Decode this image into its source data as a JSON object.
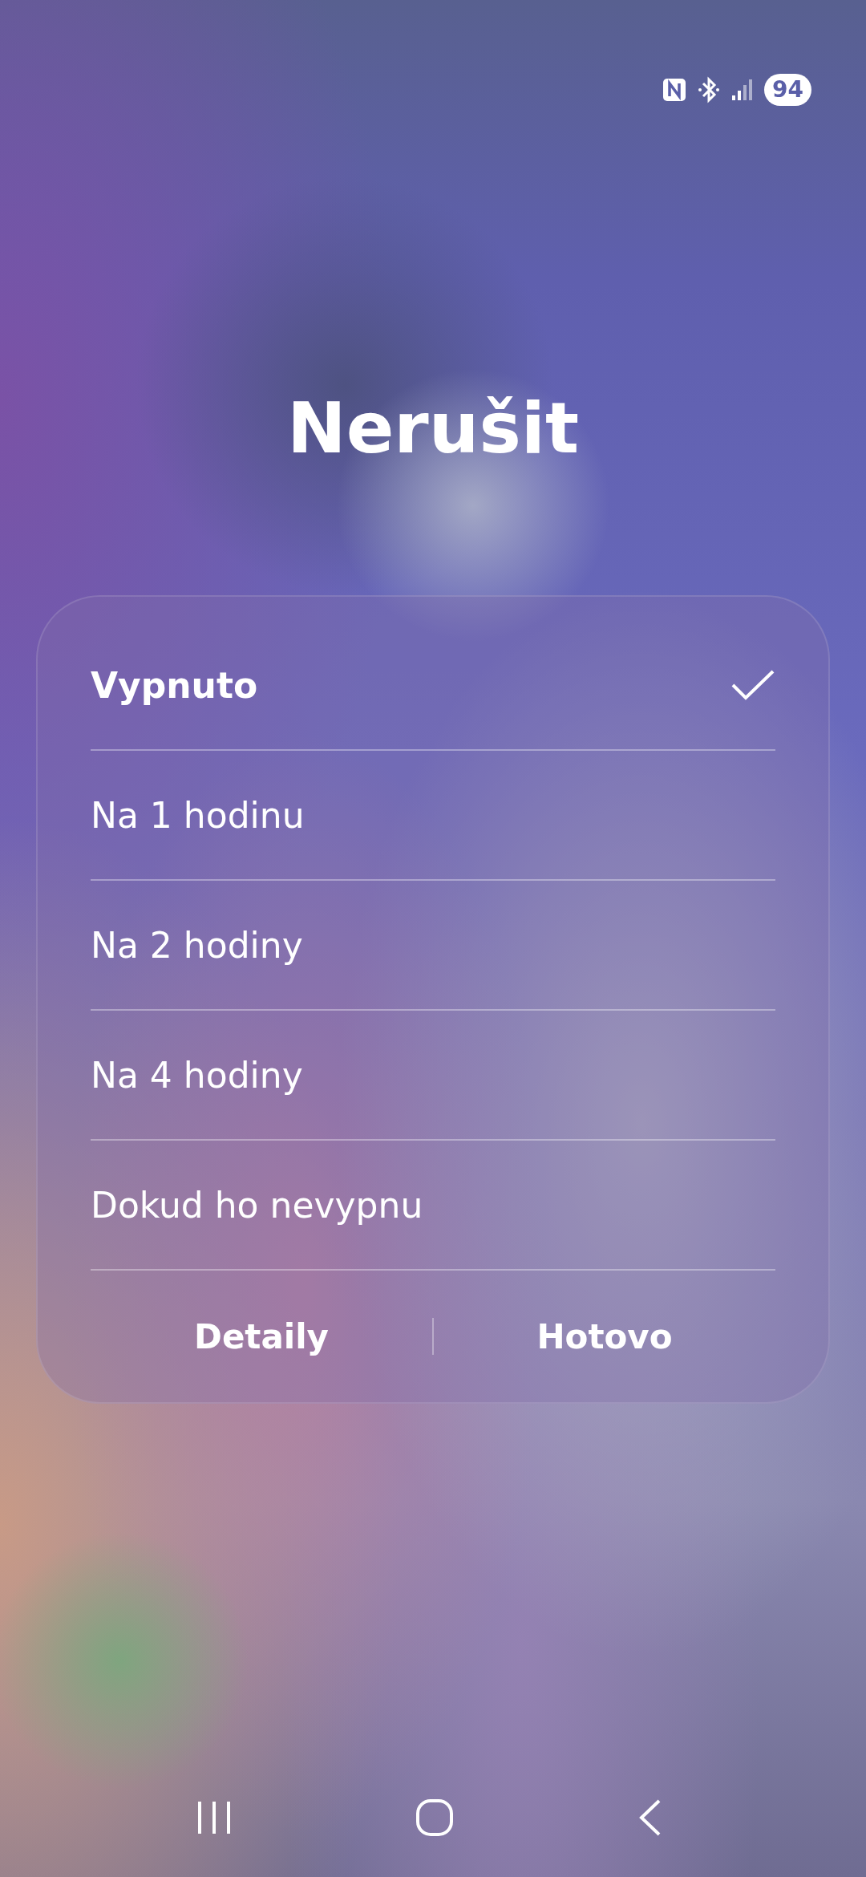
{
  "status_bar": {
    "battery": "94"
  },
  "title": "Nerušit",
  "options": [
    {
      "label": "Vypnuto",
      "selected": true
    },
    {
      "label": "Na 1 hodinu",
      "selected": false
    },
    {
      "label": "Na 2 hodiny",
      "selected": false
    },
    {
      "label": "Na 4 hodiny",
      "selected": false
    },
    {
      "label": "Dokud ho nevypnu",
      "selected": false
    }
  ],
  "buttons": [
    "Detaily",
    "Hotovo"
  ]
}
